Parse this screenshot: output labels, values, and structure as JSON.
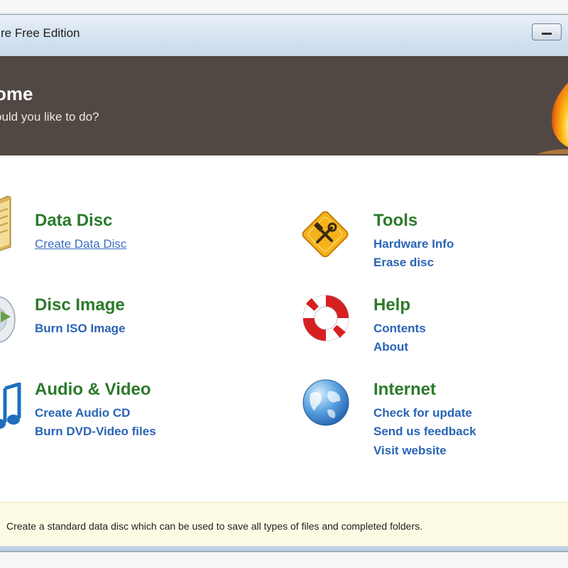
{
  "window": {
    "title": "re Free Edition"
  },
  "banner": {
    "title": "ome",
    "subtitle": "ould you like to do?"
  },
  "sections": {
    "data_disc": {
      "title": "Data Disc",
      "icon": "folder-icon",
      "links": [
        "Create Data Disc"
      ]
    },
    "disc_image": {
      "title": "Disc Image",
      "icon": "disc-image-icon",
      "links": [
        "Burn ISO Image"
      ]
    },
    "audio_video": {
      "title": "Audio & Video",
      "icon": "music-note-icon",
      "links": [
        "Create Audio CD",
        "Burn DVD-Video files"
      ]
    },
    "tools": {
      "title": "Tools",
      "icon": "tools-icon",
      "links": [
        "Hardware Info",
        "Erase disc"
      ]
    },
    "help": {
      "title": "Help",
      "icon": "lifebuoy-icon",
      "links": [
        "Contents",
        "About"
      ]
    },
    "internet": {
      "title": "Internet",
      "icon": "globe-icon",
      "links": [
        "Check for update",
        "Send us feedback",
        "Visit website"
      ]
    }
  },
  "status": {
    "description": "Create a standard data disc which can be used to save all types of files and completed folders."
  },
  "colors": {
    "banner_bg": "#524843",
    "section_title": "#2b7a2b",
    "link": "#2a64b5",
    "footer_bg": "#fdfbe4"
  }
}
